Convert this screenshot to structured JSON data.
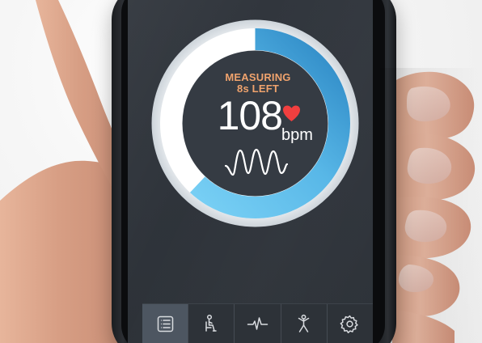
{
  "app": {
    "measurement_status": "MEASURING",
    "time_left": "8s LEFT",
    "heart_rate": "108",
    "unit": "bpm",
    "progress": 0.62
  },
  "icons": {
    "heart": "heart-icon",
    "pulse": "pulse-waveform-icon",
    "tabs": [
      "list-icon",
      "sitting-person-icon",
      "heartbeat-line-icon",
      "active-person-icon",
      "settings-gear-icon"
    ]
  },
  "colors": {
    "accent_blue": "#63c2ef",
    "accent_blue_dark": "#2b86c3",
    "status_orange": "#f0a36d",
    "heart_red": "#f13f3f",
    "screen_bg": "#31363d"
  }
}
